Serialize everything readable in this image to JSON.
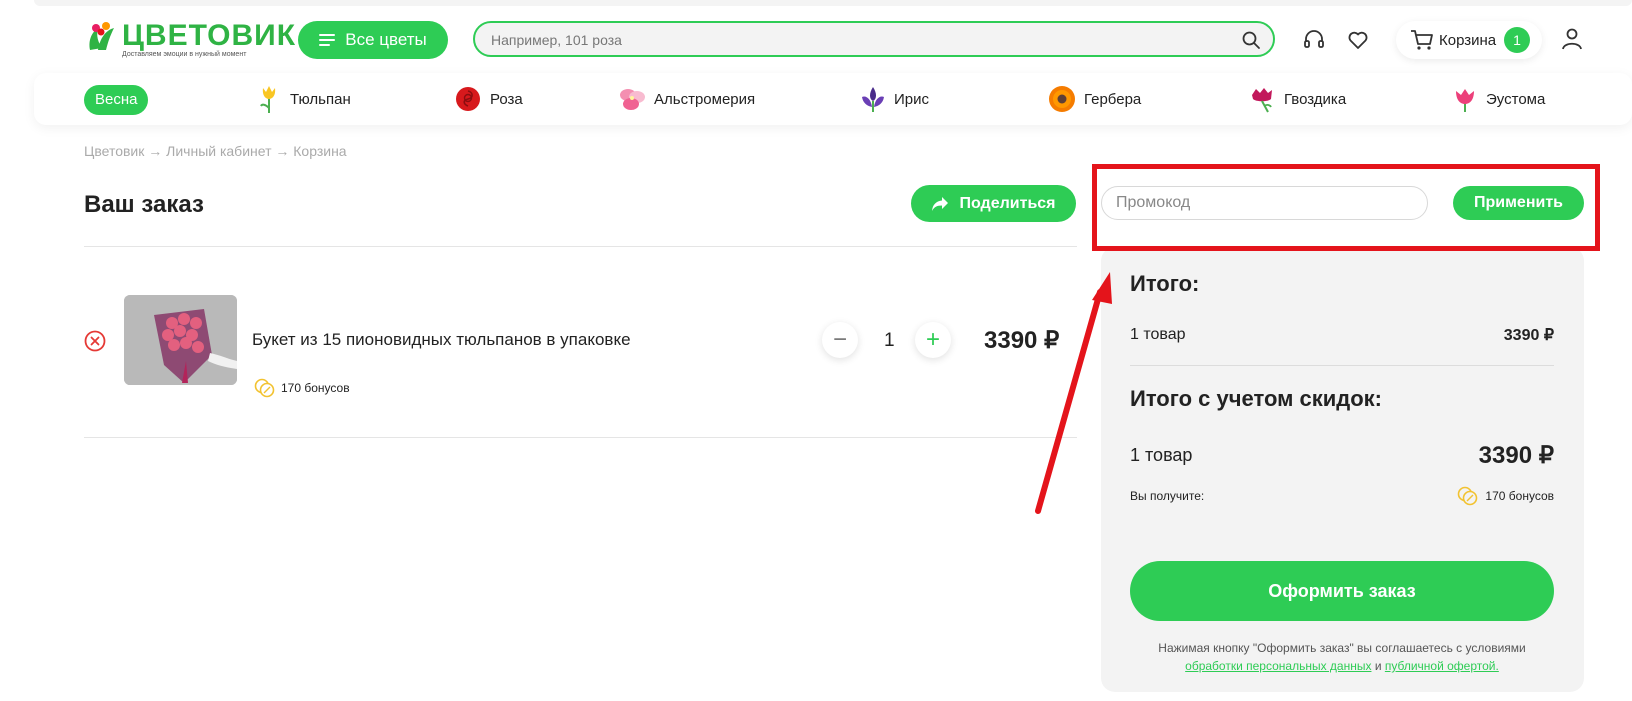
{
  "header": {
    "logo_text": "ЦВЕТОВИК",
    "logo_tagline": "Доставляем эмоции в нужный момент",
    "all_flowers_label": "Все цветы",
    "search_placeholder": "Например, 101 роза",
    "cart_label": "Корзина",
    "cart_count": "1"
  },
  "categories": {
    "active": "Весна",
    "items": [
      "Тюльпан",
      "Роза",
      "Альстромерия",
      "Ирис",
      "Гербера",
      "Гвоздика",
      "Эустома"
    ]
  },
  "breadcrumb": "Цветовик → Личный кабинет → Корзина",
  "order": {
    "title": "Ваш заказ",
    "share_label": "Поделиться",
    "item": {
      "name": "Букет из 15 пионовидных тюльпанов в упаковке",
      "bonus": "170 бонусов",
      "minus": "−",
      "quantity": "1",
      "plus": "+",
      "price": "3390 ₽"
    }
  },
  "summary": {
    "promo_placeholder": "Промокод",
    "apply_label": "Применить",
    "total_title": "Итого:",
    "total_items": "1 товар",
    "total_price": "3390 ₽",
    "discount_title": "Итого с учетом скидок:",
    "discount_items": "1 товар",
    "discount_price": "3390 ₽",
    "you_get_label": "Вы получите:",
    "you_get_bonus": "170 бонусов",
    "checkout_label": "Оформить заказ",
    "legal_text": "Нажимая кнопку \"Оформить заказ\" вы соглашаетесь с условиями",
    "legal_link1": "обработки персональных данных",
    "legal_and": "и",
    "legal_link2": "публичной офертой."
  },
  "colors": {
    "accent": "#2ecc55",
    "highlight": "#e4141b"
  }
}
